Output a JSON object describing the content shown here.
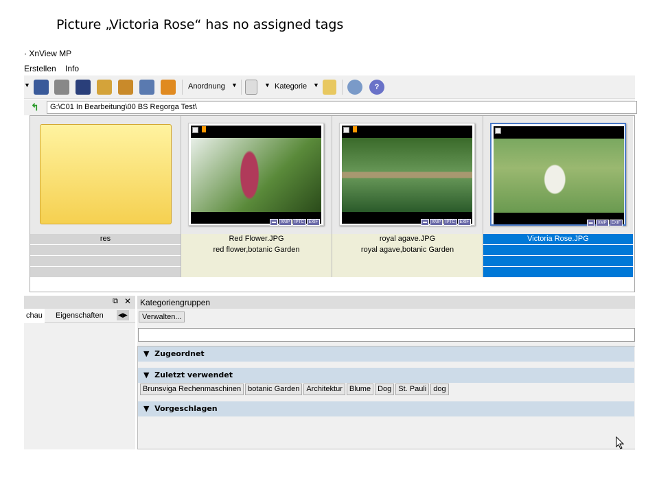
{
  "slide_title": "Picture „Victoria Rose“ has no assigned tags",
  "app_title": "· XnView MP",
  "menu": [
    "Erstellen",
    "Info"
  ],
  "toolbar": {
    "anordnung": "Anordnung",
    "kategorie": "Kategorie"
  },
  "path": "G:\\C01 In Bearbeitung\\00 BS Regorga Test\\",
  "items": [
    {
      "name": "res",
      "tags": ""
    },
    {
      "name": "Red Flower.JPG",
      "tags": "red flower,botanic Garden",
      "badges": [
        "▬",
        "XMP",
        "IPTC",
        "EXIF"
      ]
    },
    {
      "name": "royal agave.JPG",
      "tags": "royal agave,botanic Garden",
      "badges": [
        "▬",
        "XMP",
        "IPTC",
        "EXIF"
      ]
    },
    {
      "name": "Victoria Rose.JPG",
      "tags": "",
      "badges": [
        "▬",
        "XMP",
        "EXIF"
      ]
    }
  ],
  "left_panel": {
    "tabs": [
      "chau",
      "Eigenschaften"
    ]
  },
  "right_panel": {
    "header": "Kategoriengruppen",
    "manage_button": "Verwalten...",
    "search_value": "",
    "sections": [
      "Zugeordnet",
      "Zuletzt verwendet",
      "Vorgeschlagen"
    ],
    "recent_tags": [
      "Brunsviga Rechenmaschinen",
      "botanic Garden",
      "Architektur",
      "Blume",
      "Dog",
      "St. Pauli",
      "dog"
    ]
  },
  "colors": {
    "selection": "#0078d7",
    "label_bg": "#eeeed8",
    "section": "#cddbe8"
  }
}
